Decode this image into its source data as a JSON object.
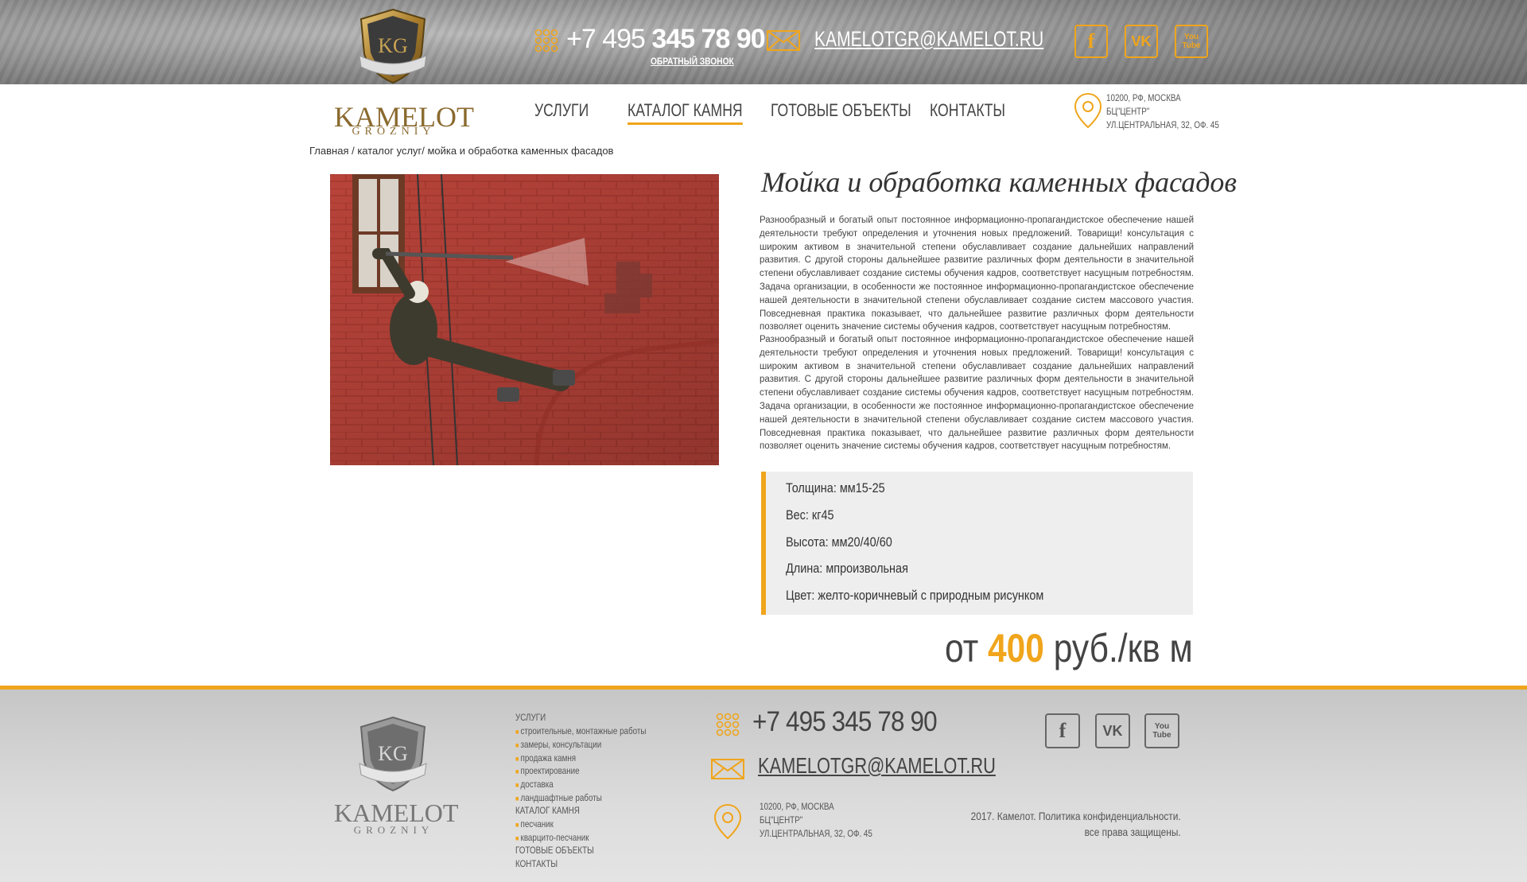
{
  "header": {
    "logo_title": "KAMELOT",
    "logo_sub": "GROZNIY",
    "logo_mark": "KG",
    "phone_prefix": "+7 495 ",
    "phone_main": "345 78 90",
    "callback": "ОБРАТНЫЙ ЗВОНОК",
    "email": "KAMELOTGR@KAMELOT.RU",
    "social": [
      "facebook-icon",
      "vk-icon",
      "youtube-icon"
    ],
    "social_labels": [
      "f",
      "VK",
      "You Tube"
    ]
  },
  "nav": {
    "items": [
      "УСЛУГИ",
      "КАТАЛОГ КАМНЯ",
      "ГОТОВЫЕ ОБЪЕКТЫ",
      "КОНТАКТЫ"
    ],
    "active": "КАТАЛОГ КАМНЯ"
  },
  "address": {
    "line1": "10200, РФ, МОСКВА",
    "line2": "БЦ\"ЦЕНТР\"",
    "line3": "УЛ.ЦЕНТРАЛЬНАЯ, 32, ОФ. 45"
  },
  "breadcrumb": "Главная / каталог услуг/ мойка и обработка каменных фасадов",
  "product": {
    "title": "Мойка и обработка каменных фасадов",
    "paragraph1": "Разнообразный и богатый опыт постоянное информационно-пропагандистское обеспечение нашей деятельности требуют определения и уточнения новых предложений. Товарищи! консультация с широким активом в значительной степени обуславливает создание дальнейших направлений развития. С другой стороны дальнейшее развитие различных форм деятельности в значительной степени обуславливает создание системы обучения кадров, соответствует насущным потребностям. Задача организации, в особенности же постоянное информационно-пропагандистское обеспечение нашей деятельности в значительной степени обуславливает создание систем массового участия. Повседневная практика показывает, что дальнейшее развитие различных форм деятельности позволяет оценить значение системы обучения кадров, соответствует насущным потребностям.",
    "paragraph2": "Разнообразный и богатый опыт постоянное информационно-пропагандистское обеспечение нашей деятельности требуют определения и уточнения новых предложений. Товарищи! консультация с широким активом в значительной степени обуславливает создание дальнейших направлений развития. С другой стороны дальнейшее развитие различных форм деятельности в значительной степени обуславливает создание системы обучения кадров, соответствует насущным потребностям. Задача организации, в особенности же постоянное информационно-пропагандистское обеспечение нашей деятельности в значительной степени обуславливает создание систем массового участия. Повседневная практика показывает, что дальнейшее развитие различных форм деятельности позволяет оценить значение системы обучения кадров, соответствует насущным потребностям.",
    "specs": [
      "Толщина: мм15-25",
      "Вес: кг45",
      "Высота: мм20/40/60",
      "Длина: мпроизвольная",
      "Цвет: желто-коричневый с природным рисунком"
    ],
    "price_prefix": "от ",
    "price_value": "400",
    "price_suffix": " руб./кв м"
  },
  "footer": {
    "menu": [
      {
        "label": "УСЛУГИ",
        "sub": false
      },
      {
        "label": "строительные, монтажные работы",
        "sub": true
      },
      {
        "label": "замеры, консультации",
        "sub": true
      },
      {
        "label": "продажа камня",
        "sub": true
      },
      {
        "label": "проектирование",
        "sub": true
      },
      {
        "label": "доставка",
        "sub": true
      },
      {
        "label": "ландшафтные работы",
        "sub": true
      },
      {
        "label": "КАТАЛОГ КАМНЯ",
        "sub": false
      },
      {
        "label": "песчаник",
        "sub": true
      },
      {
        "label": "кварцито-песчаник",
        "sub": true
      },
      {
        "label": "ГОТОВЫЕ ОБЪЕКТЫ",
        "sub": false
      },
      {
        "label": "КОНТАКТЫ",
        "sub": false
      }
    ],
    "phone": "+7 495 345 78 90",
    "email": "KAMELOTGR@KAMELOT.RU",
    "address1": "10200, РФ, МОСКВА",
    "address2": "БЦ\"ЦЕНТР\"",
    "address3": "УЛ.ЦЕНТРАЛЬНАЯ, 32, ОФ. 45",
    "copyright1": "2017. Камелот. Политика конфиденциальности.",
    "copyright2": "все права защищены."
  },
  "colors": {
    "accent": "#f0a51c",
    "text": "#333333",
    "gold": "#8a6a2f"
  }
}
